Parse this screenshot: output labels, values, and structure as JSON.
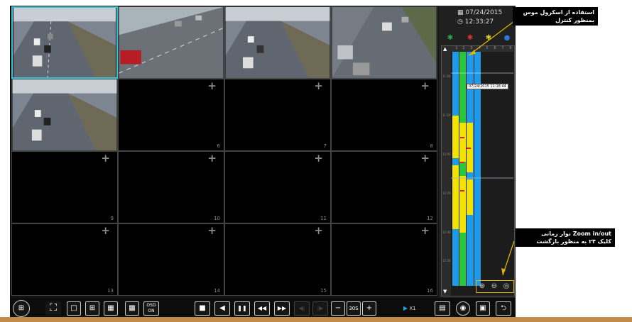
{
  "sidebar": {
    "date": "07/24/2015",
    "time": "12:33:27"
  },
  "timeline": {
    "hours": [
      "1",
      "2",
      "3",
      "4",
      "5",
      "6",
      "7",
      "8"
    ],
    "tooltip": "07/24/2015 11:18:44"
  },
  "grid": {
    "cells": [
      "",
      "",
      "",
      "",
      "",
      "6",
      "7",
      "8",
      "9",
      "10",
      "11",
      "12",
      "13",
      "14",
      "15",
      "16"
    ],
    "plus": "+"
  },
  "toolbar": {
    "osd_line1": "OSD",
    "osd_line2": "ON",
    "stop": "■",
    "back": "◀",
    "pause": "❚❚",
    "rewind": "◀◀",
    "forward": "▶▶",
    "step_back": "◀|",
    "step_fwd": "|▶",
    "minus": "−",
    "interval": "30S",
    "plus": "+",
    "speed": "X1"
  },
  "annotations": {
    "top_line1": "استفاده از اسکرول موس",
    "top_line2": "بمنظور کنترل",
    "bottom_line1": "نوار زمانی Zoom in/out",
    "bottom_line2": "کلیک ۲۴ به منظور بازگشت"
  }
}
